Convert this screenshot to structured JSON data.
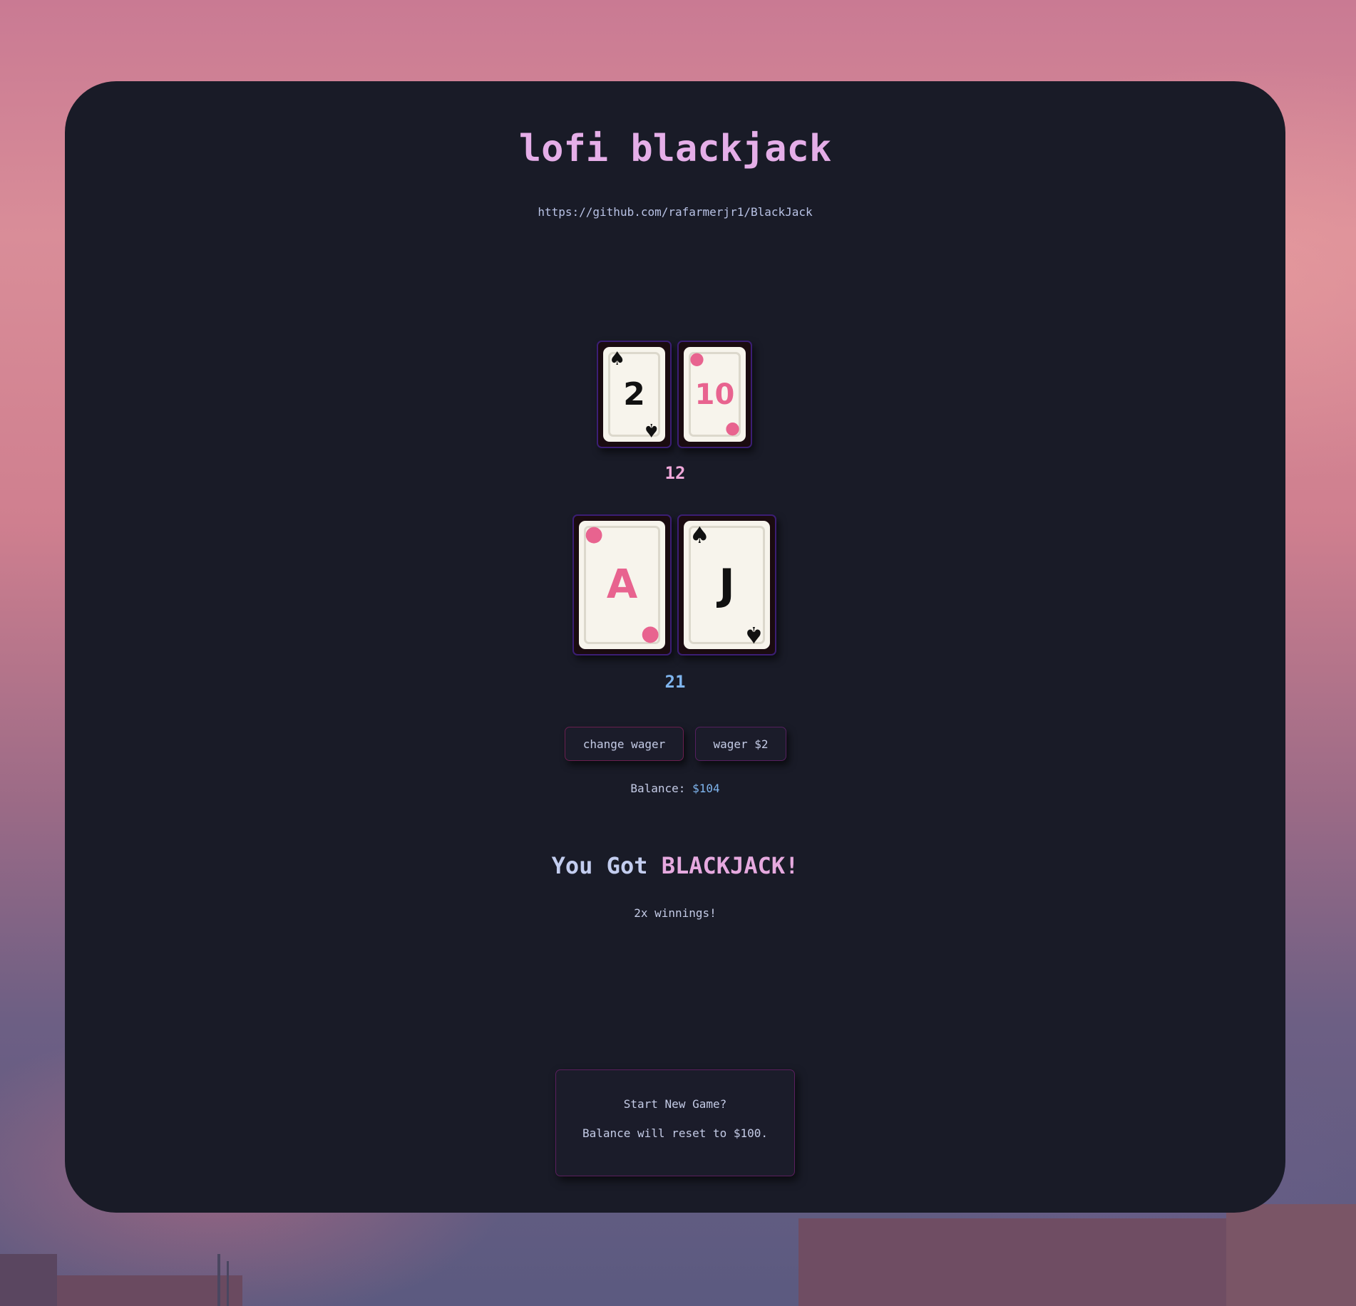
{
  "title": "lofi blackjack",
  "repo_url": "https://github.com/rafarmerjr1/BlackJack",
  "dealer": {
    "cards": [
      {
        "rank": "2",
        "suit": "spade",
        "color": "black"
      },
      {
        "rank": "10",
        "suit": "diamond",
        "color": "pink"
      }
    ],
    "score": "12"
  },
  "player": {
    "cards": [
      {
        "rank": "A",
        "suit": "diamond",
        "color": "pink"
      },
      {
        "rank": "J",
        "suit": "spade",
        "color": "black"
      }
    ],
    "score": "21"
  },
  "controls": {
    "change_wager_label": "change wager",
    "wager_label": "wager $2"
  },
  "balance": {
    "label": "Balance: ",
    "amount": "$104"
  },
  "result": {
    "prefix": "You Got ",
    "highlight": "BLACKJACK!",
    "subtext": "2x winnings!"
  },
  "new_game": {
    "line1": "Start New Game?",
    "line2": "Balance will reset to $100."
  },
  "colors": {
    "panel": "#191b27",
    "title": "#e5aee8",
    "dealer_score": "#f0a8da",
    "player_score": "#7fb5ee",
    "card_pink": "#e8638f",
    "card_border": "#3b1e74"
  }
}
